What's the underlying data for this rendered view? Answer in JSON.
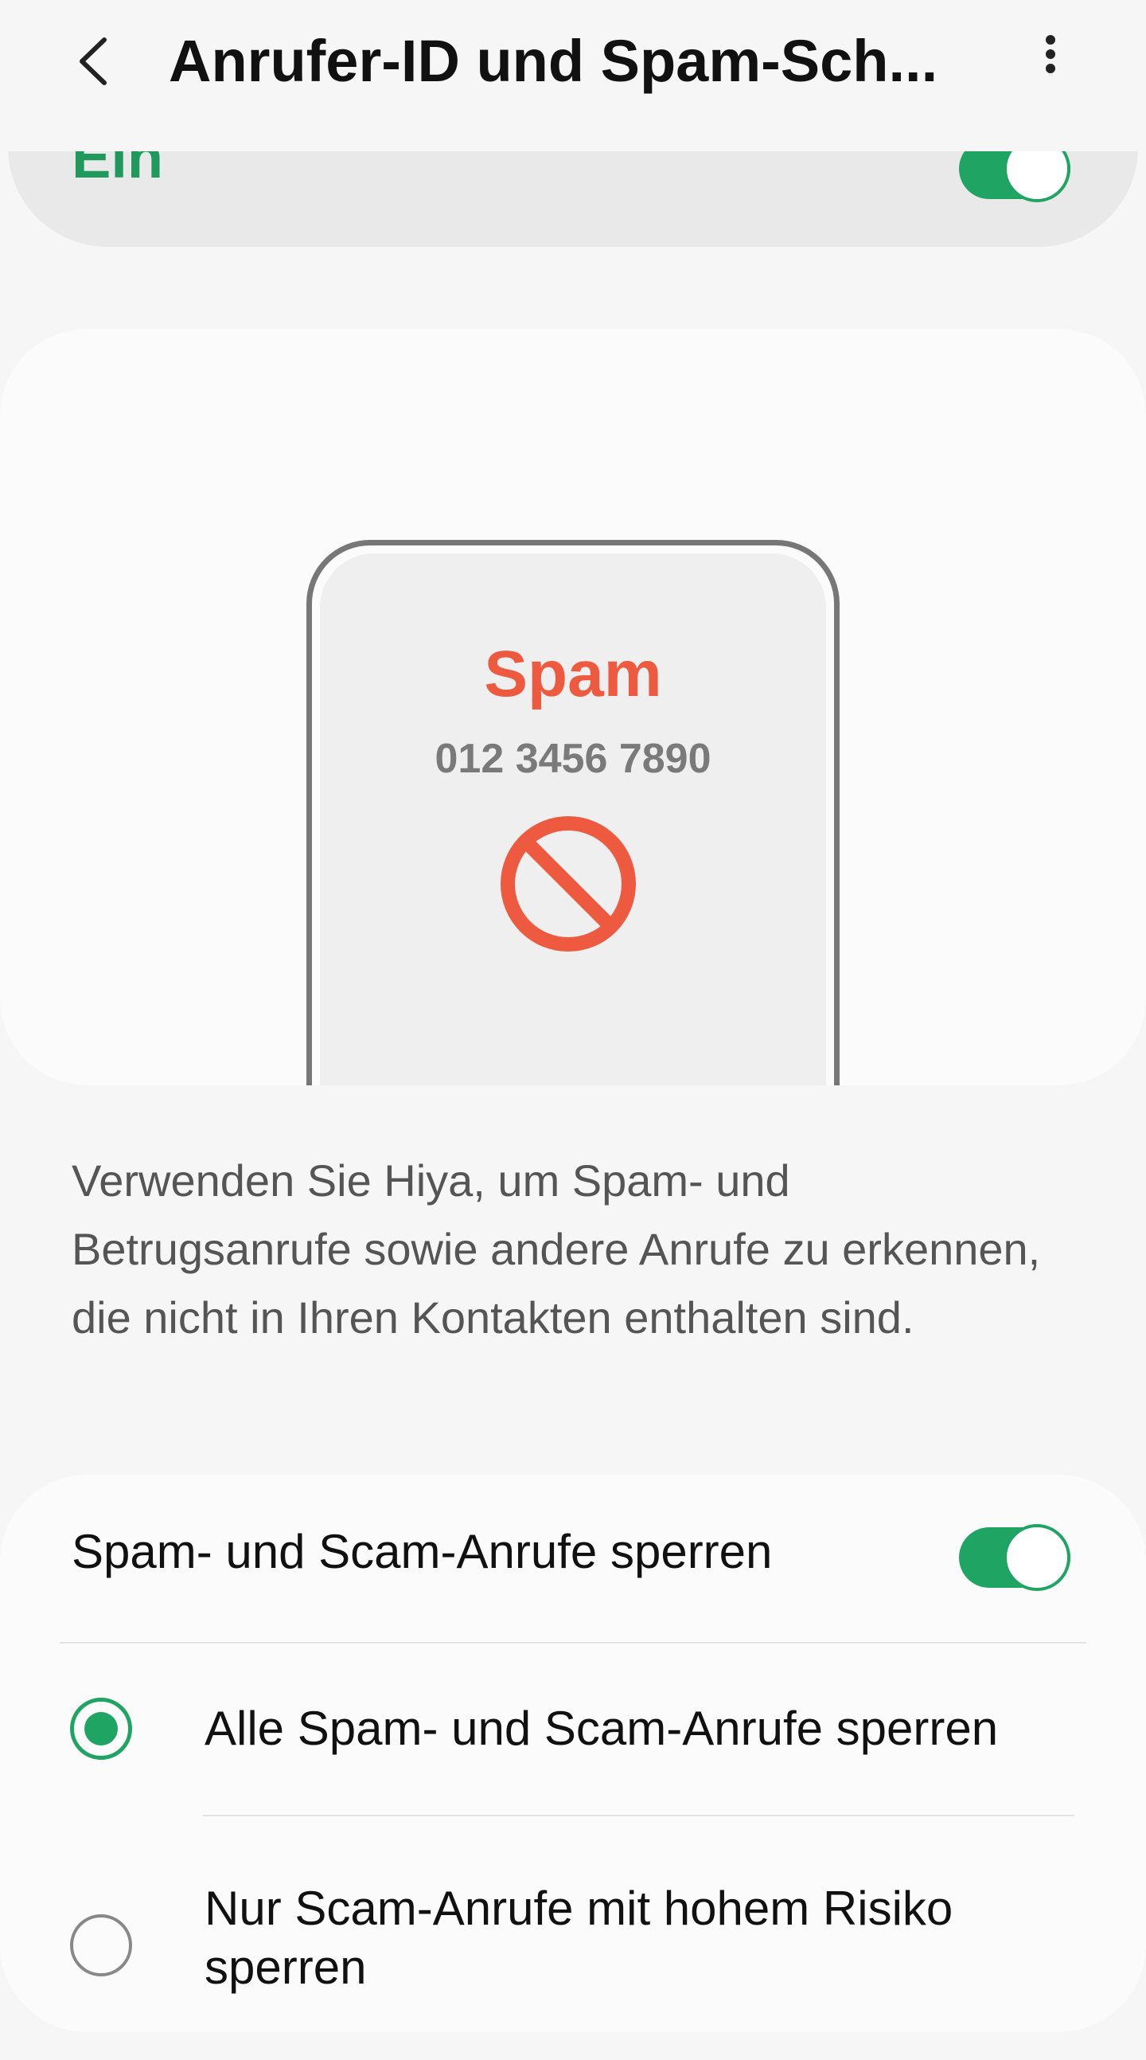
{
  "header": {
    "title": "Anrufer-ID und Spam-Sch..."
  },
  "master": {
    "label": "Ein",
    "toggle_on": true
  },
  "illustration": {
    "spam_label": "Spam",
    "phone_number": "012 3456 7890",
    "accent_color": "#ee5a3f"
  },
  "description": "Verwenden Sie Hiya, um Spam- und Betrugsanrufe sowie andere Anrufe zu erkennen, die nicht in Ihren Kontakten enthalten sind.",
  "settings": {
    "block_label": "Spam- und Scam-Anrufe sperren",
    "block_toggle_on": true,
    "options": [
      {
        "label": "Alle Spam- und Scam-Anrufe sperren",
        "selected": true
      },
      {
        "label": "Nur Scam-Anrufe mit hohem Risiko sperren",
        "selected": false
      }
    ]
  },
  "colors": {
    "accent": "#1fa463",
    "background": "#f6f6f6"
  }
}
